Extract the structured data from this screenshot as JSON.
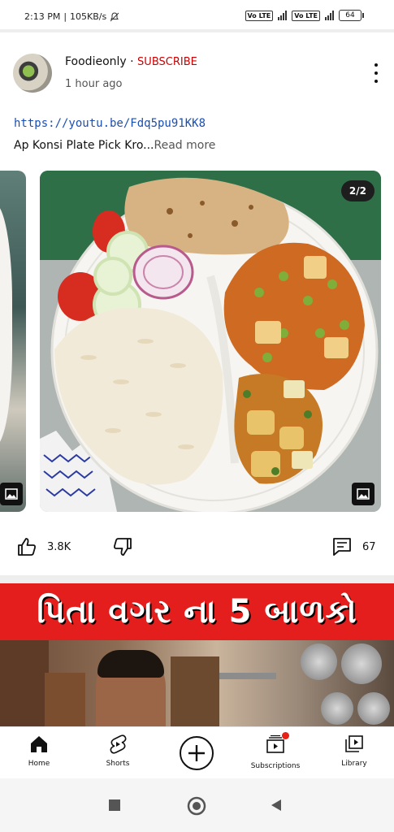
{
  "status_bar": {
    "time": "2:13 PM",
    "speed": "105KB/s",
    "battery": "64",
    "volte1": "Vo LTE",
    "volte2": "Vo LTE"
  },
  "post": {
    "channel": "Foodieonly",
    "separator": "·",
    "subscribe": "SUBSCRIBE",
    "time": "1 hour ago",
    "link": "https://youtu.be/Fdq5pu91KK8",
    "caption": "Ap Konsi Plate Pick Kro...",
    "read_more": "Read more",
    "image_counter": "2/2"
  },
  "actions": {
    "likes": "3.8K",
    "comments": "67"
  },
  "next_video": {
    "thumbnail_title": "પિતા વગર ના 5 બાળકો"
  },
  "bottom_nav": {
    "items": [
      {
        "label": "Home",
        "icon": "home-icon"
      },
      {
        "label": "Shorts",
        "icon": "shorts-icon"
      },
      {
        "label": "",
        "icon": "create-icon"
      },
      {
        "label": "Subscriptions",
        "icon": "subscriptions-icon"
      },
      {
        "label": "Library",
        "icon": "library-icon"
      }
    ]
  },
  "colors": {
    "subscribe": "#cc0000",
    "link": "#1a4fb0",
    "notification_dot": "#e62117",
    "thumbnail_banner": "#e41d1d"
  }
}
